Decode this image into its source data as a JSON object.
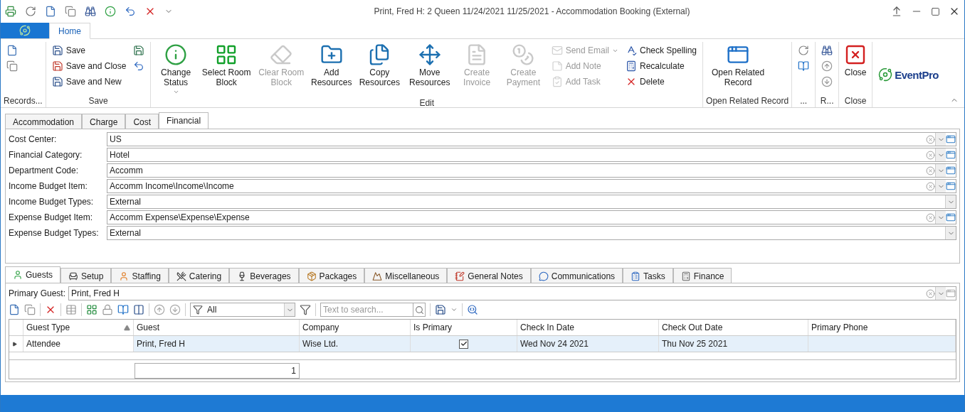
{
  "window": {
    "title": "Print, Fred H: 2 Queen 11/24/2021 11/25/2021  - Accommodation Booking (External)"
  },
  "ribbon_tabs": [
    {
      "label": "Home",
      "selected": true
    }
  ],
  "ribbon_groups": [
    {
      "label": "Records...",
      "columns": [
        {
          "kind": "stack",
          "items": [
            {
              "disabled": false
            },
            {
              "disabled": false
            }
          ]
        }
      ]
    },
    {
      "label": "Save",
      "columns": [
        {
          "kind": "stack",
          "items": [
            {
              "label": "Save",
              "disabled": false
            },
            {
              "label": "Save and Close",
              "disabled": false
            },
            {
              "label": "Save and New",
              "disabled": false
            }
          ]
        },
        {
          "kind": "stack",
          "items": [
            {
              "disabled": false
            },
            {
              "disabled": false
            }
          ]
        }
      ]
    },
    {
      "label": "Edit",
      "columns": [
        {
          "kind": "large",
          "label": "Change Status",
          "disabled": false,
          "dropdown": true
        },
        {
          "kind": "large",
          "label": "Select Room Block",
          "disabled": false
        },
        {
          "kind": "large",
          "label": "Clear Room Block",
          "disabled": true
        },
        {
          "kind": "large",
          "label": "Add Resources",
          "disabled": false
        },
        {
          "kind": "large",
          "label": "Copy Resources",
          "disabled": false
        },
        {
          "kind": "large",
          "label": "Move Resources",
          "disabled": false
        },
        {
          "kind": "large",
          "label": "Create Invoice",
          "disabled": true
        },
        {
          "kind": "large",
          "label": "Create Payment",
          "disabled": true
        },
        {
          "kind": "stack",
          "items": [
            {
              "label": "Send Email",
              "disabled": true,
              "dropdown": true
            },
            {
              "label": "Add Note",
              "disabled": true
            },
            {
              "label": "Add Task",
              "disabled": true
            }
          ]
        },
        {
          "kind": "stack",
          "items": [
            {
              "label": "Check Spelling",
              "disabled": false
            },
            {
              "label": "Recalculate",
              "disabled": false
            },
            {
              "label": "Delete",
              "disabled": false
            }
          ]
        }
      ]
    },
    {
      "label": "Open Related Record",
      "columns": [
        {
          "kind": "large",
          "label": "Open Related Record",
          "disabled": false
        }
      ]
    },
    {
      "label": "...",
      "columns": [
        {
          "kind": "stack",
          "items": [
            {
              "disabled": false
            },
            {
              "disabled": false
            }
          ]
        }
      ]
    },
    {
      "label": "R...",
      "columns": [
        {
          "kind": "stack",
          "items": [
            {
              "disabled": false
            },
            {
              "disabled": false
            },
            {
              "disabled": false
            }
          ]
        }
      ]
    },
    {
      "label": "Close",
      "columns": [
        {
          "kind": "large",
          "label": "Close",
          "disabled": false
        }
      ]
    }
  ],
  "logo": {
    "text": "EventPro"
  },
  "form_tabs": [
    {
      "label": "Accommodation",
      "selected": false
    },
    {
      "label": "Charge",
      "selected": false
    },
    {
      "label": "Cost",
      "selected": false
    },
    {
      "label": "Financial",
      "selected": true
    }
  ],
  "fields": [
    {
      "label": "Cost Center:",
      "value": "US",
      "kind": "lookup"
    },
    {
      "label": "Financial Category:",
      "value": "Hotel",
      "kind": "lookup"
    },
    {
      "label": "Department Code:",
      "value": "Accomm",
      "kind": "lookup"
    },
    {
      "label": "Income Budget Item:",
      "value": "Accomm Income\\Income\\Income",
      "kind": "lookup"
    },
    {
      "label": "Income Budget Types:",
      "value": "External",
      "kind": "select"
    },
    {
      "label": "Expense Budget Item:",
      "value": "Accomm Expense\\Expense\\Expense",
      "kind": "lookup"
    },
    {
      "label": "Expense Budget Types:",
      "value": "External",
      "kind": "select"
    }
  ],
  "detail_tabs": [
    {
      "label": "Guests",
      "selected": true
    },
    {
      "label": "Setup",
      "selected": false
    },
    {
      "label": "Staffing",
      "selected": false
    },
    {
      "label": "Catering",
      "selected": false
    },
    {
      "label": "Beverages",
      "selected": false
    },
    {
      "label": "Packages",
      "selected": false
    },
    {
      "label": "Miscellaneous",
      "selected": false
    },
    {
      "label": "General Notes",
      "selected": false
    },
    {
      "label": "Communications",
      "selected": false
    },
    {
      "label": "Tasks",
      "selected": false
    },
    {
      "label": "Finance",
      "selected": false
    }
  ],
  "primary_guest": {
    "label": "Primary Guest:",
    "value": "Print, Fred H"
  },
  "grid_toolbar": {
    "filter": "All",
    "search_placeholder": "Text to search..."
  },
  "table": {
    "columns": [
      {
        "label": "Guest Type",
        "sorted": true
      },
      {
        "label": "Guest",
        "sorted": false
      },
      {
        "label": "Company",
        "sorted": false
      },
      {
        "label": "Is Primary",
        "sorted": false
      },
      {
        "label": "Check In Date",
        "sorted": false
      },
      {
        "label": "Check Out Date",
        "sorted": false
      },
      {
        "label": "Primary Phone",
        "sorted": false
      }
    ],
    "rows": [
      {
        "selected": true,
        "guest_type": "Attendee",
        "guest": "Print, Fred H",
        "company": "Wise Ltd.",
        "is_primary": true,
        "check_in": "Wed Nov 24 2021",
        "check_out": "Thu Nov 25 2021"
      }
    ],
    "summary": "1"
  }
}
